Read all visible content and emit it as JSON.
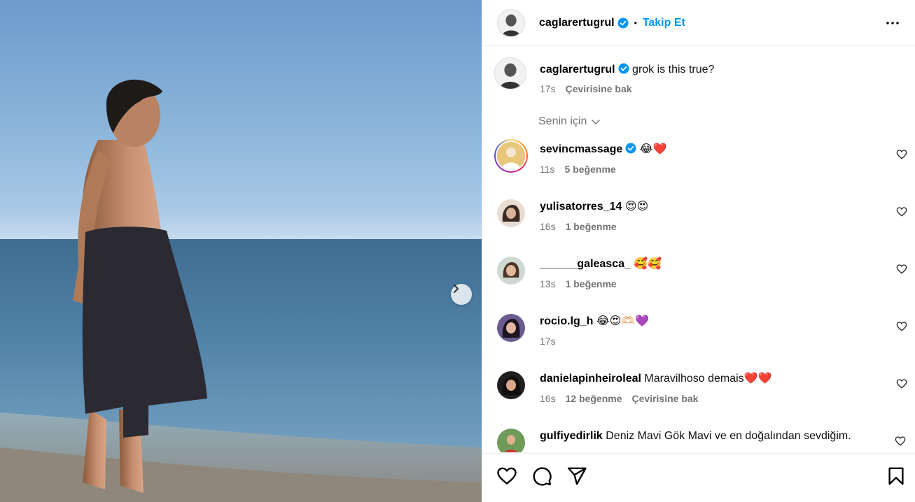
{
  "post": {
    "author": "caglarertugrul",
    "follow_label": "Takip Et",
    "dot": "•"
  },
  "caption": {
    "username": "caglarertugrul",
    "text": "grok is this true?",
    "time": "17s",
    "translate_label": "Çevirisine bak"
  },
  "comments_filter": {
    "label": "Senin için"
  },
  "comments": [
    {
      "username": "sevincmassage",
      "text": "😂❤️",
      "time": "11s",
      "likes": "5 beğenme"
    },
    {
      "username": "yulisatorres_14",
      "text": "😍😍",
      "time": "16s",
      "likes": "1 beğenme"
    },
    {
      "username": "______galeasca_",
      "text": "🥰🥰",
      "time": "13s",
      "likes": "1 beğenme"
    },
    {
      "username": "rocio.lg_h",
      "text": "😂😍🫶🏻💜",
      "time": "17s"
    },
    {
      "username": "danielapinheiroleal",
      "text": "Maravilhoso demais❤️❤️",
      "time": "16s",
      "likes": "12 beğenme",
      "translate": "Çevirisine bak"
    },
    {
      "username": "gulfiyedirlik",
      "text": "Deniz Mavi Gök Mavi ve en doğalından sevdiğim."
    }
  ],
  "icons": {
    "verified": "verified-badge-icon",
    "more": "more-horizontal-icon",
    "like": "heart-icon",
    "comment": "comment-bubble-icon",
    "share": "paper-plane-icon",
    "save": "bookmark-icon",
    "next": "chevron-right-icon",
    "filter": "chevron-down-icon"
  },
  "colors": {
    "accent": "#0095f6",
    "muted": "#737373",
    "verified": "#0095f6"
  }
}
